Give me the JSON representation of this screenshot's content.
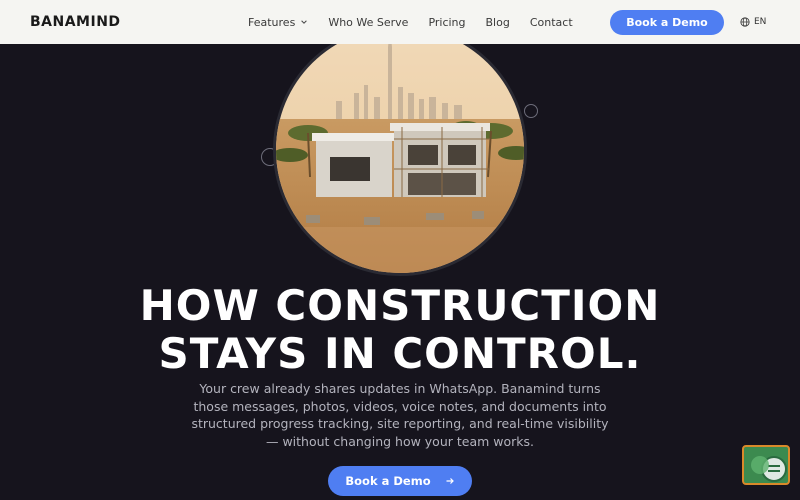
{
  "header": {
    "logo": "BANAMIND",
    "nav": [
      {
        "label": "Features"
      },
      {
        "label": "Who We Serve"
      },
      {
        "label": "Pricing"
      },
      {
        "label": "Blog"
      },
      {
        "label": "Contact"
      }
    ],
    "cta_label": "Book a Demo",
    "language": "EN"
  },
  "hero": {
    "title_line1": "HOW CONSTRUCTION",
    "title_line2": "STAYS IN CONTROL.",
    "subtitle": "Your crew already shares updates in WhatsApp. Banamind turns those messages, photos, videos, voice notes, and documents into structured progress tracking, site reporting, and real-time visibility — without changing how your team works.",
    "cta_label": "Book a Demo"
  },
  "colors": {
    "accent": "#4f7ef2",
    "background": "#16141d",
    "header_bg": "#f5f5f2"
  },
  "icons": {
    "features_chevron": "chevron-down-icon",
    "language": "globe-icon",
    "cta_arrow": "arrow-right-icon",
    "chat": "chat-widget-icon"
  }
}
